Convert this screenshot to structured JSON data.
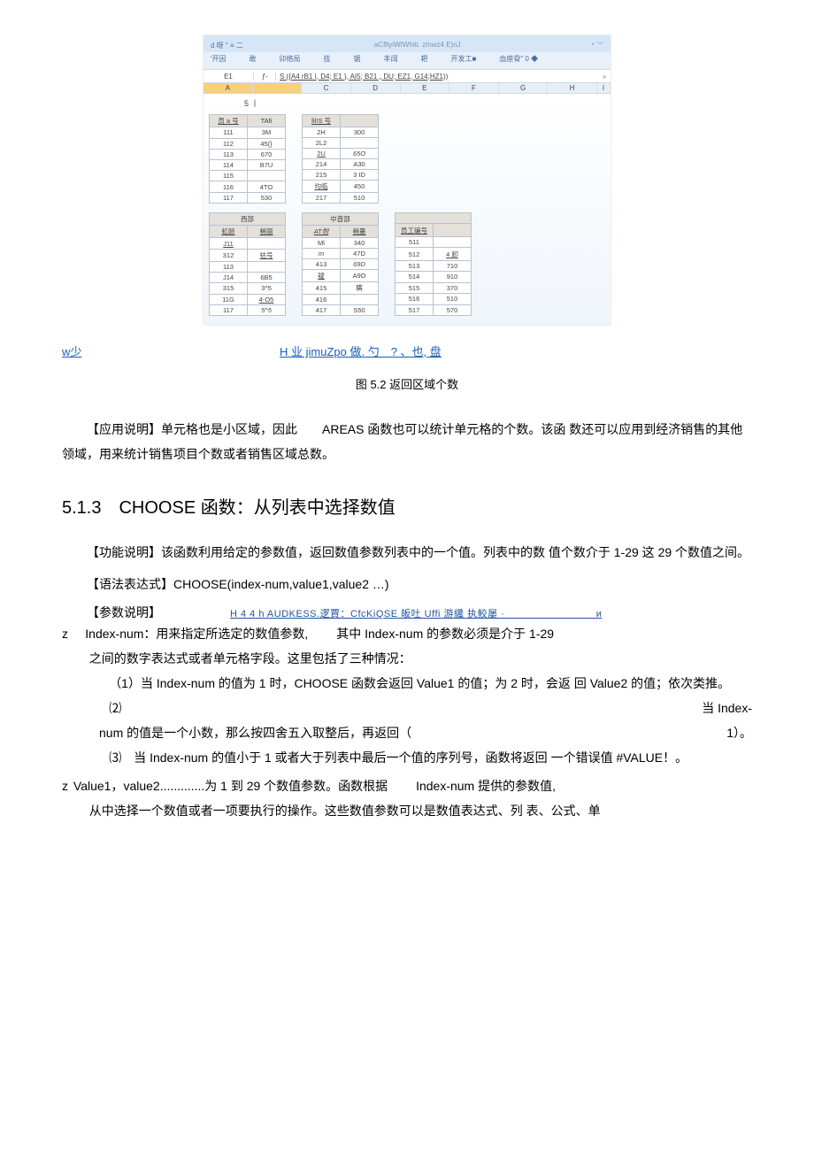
{
  "excel": {
    "ribbon_left": "d 呀 \" ≡ 二",
    "ribbon_mid": "aCfltyiWIWhiti. z/nwz4 E)nJ",
    "ribbon_right": "* ﹀",
    "menu": {
      "m1": "'开因",
      "m2": "敢",
      "m3": "卯络局",
      "m4": "技",
      "m5": "锯",
      "m6": "丰阔",
      "m7": "耙",
      "m8": "开发工■",
      "m9": "血座骨\" 0 ◆"
    },
    "namebox": "E1",
    "fx": "ƒ-",
    "formula": "S ({A4 rB1 I, D4; E1 }, AI5; B21 „ DU; EZ1, G14;HZ1))",
    "gg": "»",
    "cols": [
      "A",
      "",
      "C",
      "D",
      "E",
      "F",
      "G",
      "H",
      "I"
    ],
    "big5": "5 丨",
    "t1": {
      "h1": "员 а 号",
      "h2": "TAfi",
      "rows": [
        [
          "111",
          "3M"
        ],
        [
          "112",
          "45{}"
        ],
        [
          "113",
          "670"
        ],
        [
          "114",
          "B7U"
        ],
        [
          "115",
          ""
        ],
        [
          "116",
          "4TO"
        ],
        [
          "117",
          "530"
        ]
      ]
    },
    "t2": {
      "h1": "fil!S 号",
      "h2": "",
      "rows": [
        [
          "2H",
          "300"
        ],
        [
          "2L2",
          ""
        ],
        [
          "2U",
          "65O"
        ],
        [
          "214",
          "A30"
        ],
        [
          "215",
          "3 ID"
        ],
        [
          "均临",
          "450"
        ],
        [
          "217",
          "510"
        ]
      ]
    },
    "t3": {
      "sect": "西部",
      "h1": "虹龄",
      "h2": "梢丽",
      "rows": [
        [
          "J11",
          ""
        ],
        [
          "312",
          "祜号"
        ],
        [
          "113",
          ""
        ],
        [
          "J14",
          "6B5"
        ],
        [
          "315",
          "3^5"
        ],
        [
          "11G",
          "4-O5"
        ],
        [
          "117",
          "5^5"
        ]
      ]
    },
    "t4": {
      "sect": "中酋部",
      "h1": "AT刎",
      "h2": "梢量",
      "rows": [
        [
          "Ml",
          "340"
        ],
        [
          "m",
          "47D"
        ],
        [
          "413",
          "69D"
        ],
        [
          "疑",
          "A9O"
        ],
        [
          "415",
          "瞒"
        ],
        [
          "416",
          ""
        ],
        [
          "417",
          "S50"
        ]
      ]
    },
    "t5": {
      "h1": "员工编号",
      "h2": "",
      "rows": [
        [
          "511",
          ""
        ],
        [
          "512",
          "4 卸"
        ],
        [
          "513",
          "710"
        ],
        [
          "514",
          "910"
        ],
        [
          "515",
          "370"
        ],
        [
          "516",
          "510"
        ],
        [
          "517",
          "570"
        ]
      ]
    }
  },
  "link_line": {
    "left": "w少",
    "right": "H 业 jimuZpo 做. 勺　? 、也, 盘"
  },
  "caption": "图 5.2 返回区域个数",
  "p_app": "【应用说明】单元格也是小区域，因此　　AREAS 函数也可以统计单元格的个数。该函 数还可以应用到经济销售的其他领域，用来统计销售项目个数或者销售区域总数。",
  "h2": "5.1.3　CHOOSE 函数：从列表中选择数值",
  "p_func": "【功能说明】该函数利用给定的参数值，返回数值参数列表中的一个值。列表中的数 值个数介于 1-29 这 29 个数值之间。",
  "p_syntax": "【语法表达式】CHOOSE(index-num,value1,value2 …)",
  "p_param_label": "【参数说明】",
  "p_param_link": "H 4 4 h AUDKESS.逻賈：CfcKiQSE 皈吐 Uffi 游纔 执鲛屡 ·　　　　　　　　　и",
  "b1": {
    "line1_a": "Index-num：用来指定所选定的数值参数,",
    "line1_b": "其中 Index-num 的参数必须是介于  1-29",
    "line2": "之间的数字表达式或者单元格字段。这里包括了三种情况：",
    "s1": "（1）当 Index-num 的值为 1 时，CHOOSE 函数会返回  Value1 的值；为 2 时，会返 回 Value2 的值；依次类推。",
    "s2a": "⑵",
    "s2b": "当 Index-",
    "s2c": "num 的值是一个小数，那么按四舍五入取整后，再返回（",
    "s2d": "1）。",
    "s3": "⑶　当 Index-num 的值小于 1 或者大于列表中最后一个值的序列号，函数将返回 一个错误值 #VALUE！。"
  },
  "b2": {
    "line1_a": "Value1，value2.............为 1 到 29 个数值参数。函数根据",
    "line1_b": "Index-num 提供的参数值,",
    "line2": "从中选择一个数值或者一项要执行的操作。这些数值参数可以是数值表达式、列 表、公式、单"
  }
}
